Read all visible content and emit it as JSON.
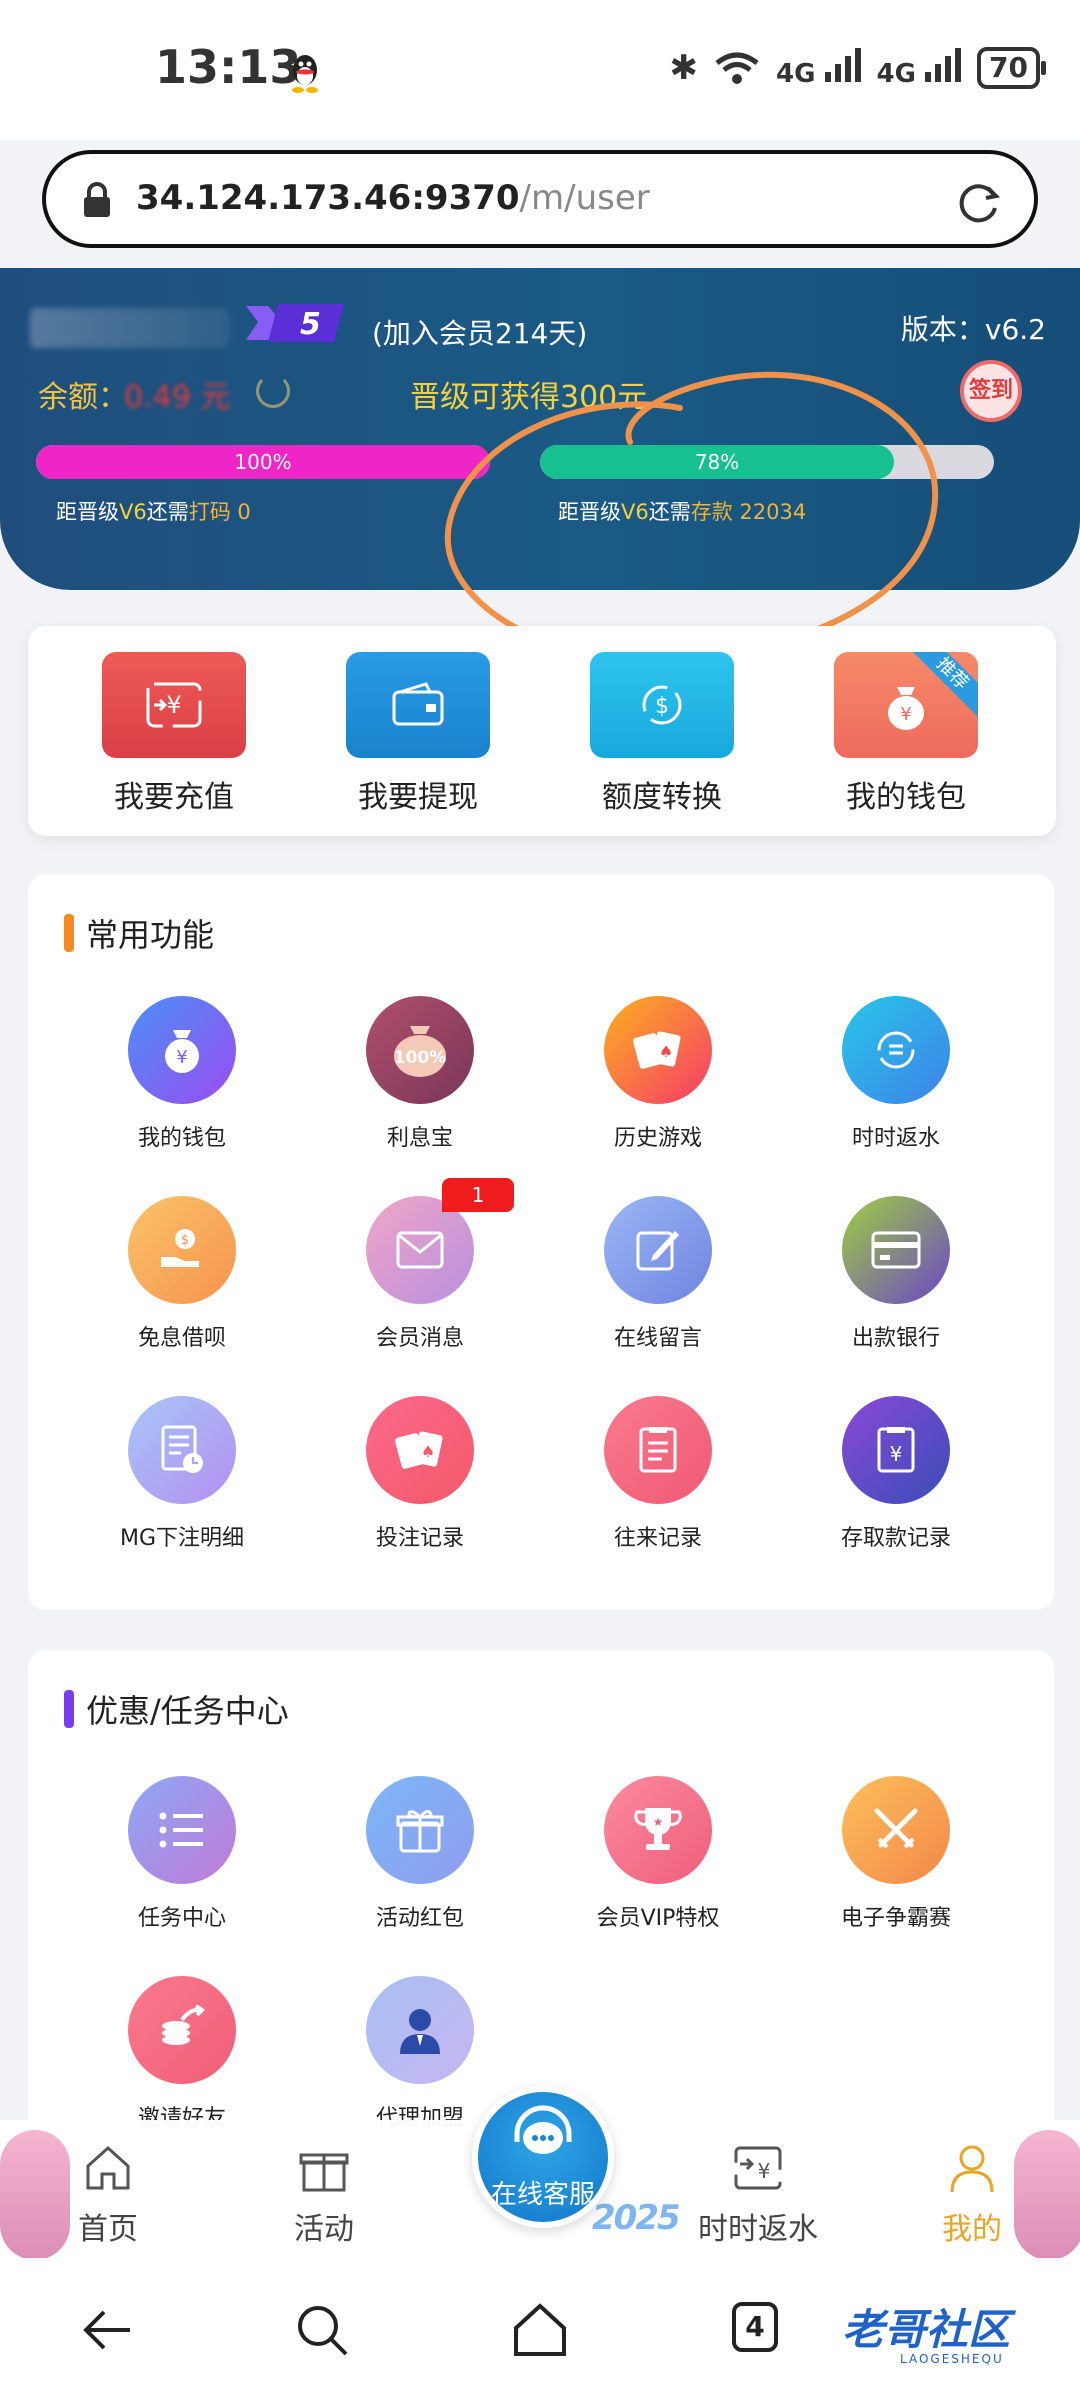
{
  "status_bar": {
    "time": "13:13",
    "network1": "4G",
    "network2": "4G",
    "battery": "70"
  },
  "url_bar": {
    "host": "34.124.173.46:9370",
    "path": "/m/user"
  },
  "header": {
    "vip_level": "5",
    "member_days": "(加入会员214天)",
    "version": "版本：v6.2",
    "balance_label": "余额：",
    "balance_value": "0.49 元",
    "upgrade_text": "晋级可获得300元",
    "sign_in": "签到",
    "progress_bet": {
      "percent_label": "100%",
      "fraction": 1.0,
      "note_prefix": "距晋级",
      "note_level": "V6",
      "note_mid": "还需",
      "note_kind": "打码",
      "note_value": "0"
    },
    "progress_deposit": {
      "percent_label": "78%",
      "fraction": 0.78,
      "note_prefix": "距晋级",
      "note_level": "V6",
      "note_mid": "还需",
      "note_kind": "存款",
      "note_value": "22034"
    }
  },
  "quick_actions": [
    {
      "label": "我要充值",
      "icon": "deposit-icon",
      "color": "#e8504f"
    },
    {
      "label": "我要提现",
      "icon": "wallet-withdraw-icon",
      "color": "#1e8fd8"
    },
    {
      "label": "额度转换",
      "icon": "transfer-icon",
      "color": "#22b7e8"
    },
    {
      "label": "我的钱包",
      "icon": "money-bag-icon",
      "color": "#f0765e",
      "badge": "推荐"
    }
  ],
  "common": {
    "title": "常用功能",
    "items": [
      {
        "label": "我的钱包"
      },
      {
        "label": "利息宝",
        "glyph": "100%"
      },
      {
        "label": "历史游戏"
      },
      {
        "label": "时时返水"
      },
      {
        "label": "免息借呗"
      },
      {
        "label": "会员消息",
        "badge": "1"
      },
      {
        "label": "在线留言"
      },
      {
        "label": "出款银行"
      },
      {
        "label": "MG下注明细"
      },
      {
        "label": "投注记录"
      },
      {
        "label": "往来记录"
      },
      {
        "label": "存取款记录"
      }
    ]
  },
  "promo": {
    "title": "优惠/任务中心",
    "items": [
      {
        "label": "任务中心"
      },
      {
        "label": "活动红包"
      },
      {
        "label": "会员VIP特权"
      },
      {
        "label": "电子争霸赛"
      },
      {
        "label": "邀请好友"
      },
      {
        "label": "代理加盟"
      }
    ]
  },
  "tabbar": {
    "home": "首页",
    "activity": "活动",
    "service": "在线客服",
    "rebate": "时时返水",
    "mine": "我的",
    "deco_year": "2025"
  },
  "navbar": {
    "tab_count": "4"
  },
  "watermark": {
    "main": "老哥社区",
    "sub": "LAOGESHEQU"
  },
  "colors": {
    "header_bg": "#1c527f",
    "accent_gold": "#f7d13a",
    "active_tab": "#e8a424"
  }
}
